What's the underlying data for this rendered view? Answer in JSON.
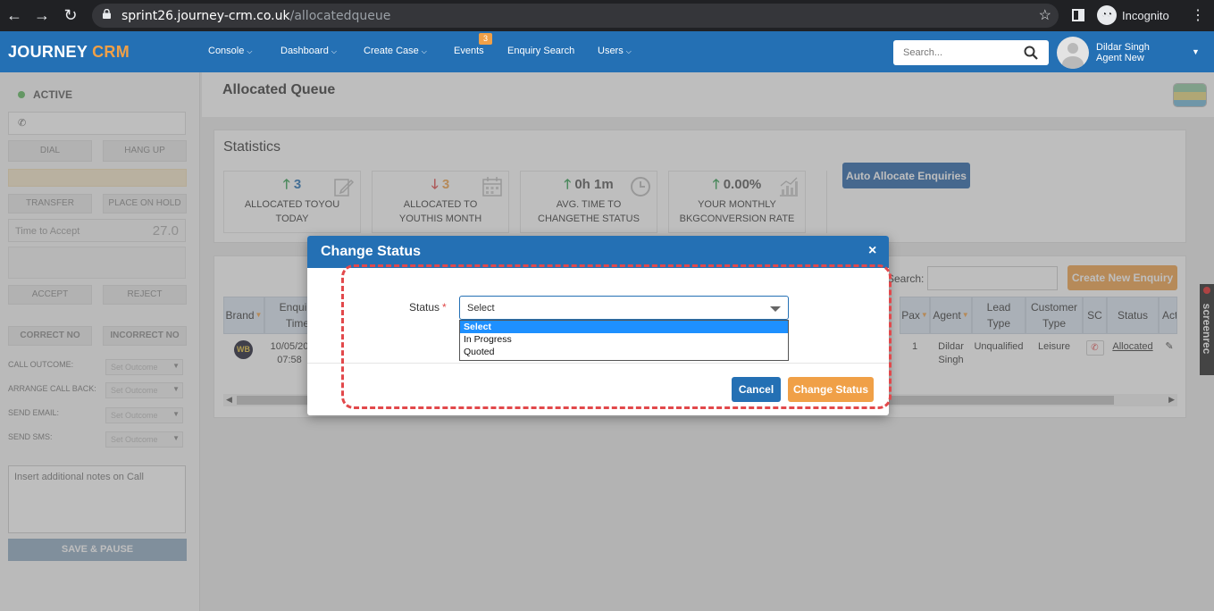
{
  "browser": {
    "url_host": "sprint26.journey-crm.co.uk",
    "url_path": "/allocatedqueue",
    "incognito_label": "Incognito"
  },
  "app": {
    "logo_main": "JOURNEY ",
    "logo_accent": "CRM",
    "menu": [
      {
        "label": "Console",
        "caret": true
      },
      {
        "label": "Dashboard",
        "caret": true
      },
      {
        "label": "Create Case",
        "caret": true
      },
      {
        "label": "Events",
        "caret": false,
        "badge": "3"
      },
      {
        "label": "Enquiry Search",
        "caret": false
      },
      {
        "label": "Users",
        "caret": true
      }
    ],
    "search_placeholder": "Search...",
    "user_name": "Dildar Singh",
    "user_role": "Agent New"
  },
  "left_panel": {
    "status": "ACTIVE",
    "dial": "DIAL",
    "hang_up": "HANG UP",
    "transfer": "TRANSFER",
    "place_on_hold": "PLACE ON HOLD",
    "time_to_accept": "Time to Accept",
    "time_value": "27.0",
    "accept": "ACCEPT",
    "reject": "REJECT",
    "correct_no": "CORRECT NO",
    "incorrect_no": "INCORRECT NO",
    "rows": [
      {
        "label": "CALL OUTCOME:",
        "value": "Set Outcome"
      },
      {
        "label": "ARRANGE CALL BACK:",
        "value": "Set Outcome"
      },
      {
        "label": "SEND EMAIL:",
        "value": "Set Outcome"
      },
      {
        "label": "SEND SMS:",
        "value": "Set Outcome"
      }
    ],
    "notes_placeholder": "Insert additional notes on Call",
    "save_pause": "SAVE & PAUSE"
  },
  "page": {
    "title": "Allocated Queue",
    "stats_title": "Statistics",
    "stats": [
      {
        "value": "3",
        "trend": "up",
        "line1": "ALLOCATED TOYOU",
        "line2": "TODAY",
        "icon": "edit-icon"
      },
      {
        "value": "3",
        "trend": "down",
        "line1": "ALLOCATED TO",
        "line2": "YOUTHIS MONTH",
        "icon": "calendar-icon"
      },
      {
        "value": "0h 1m",
        "trend": "up",
        "line1": "AVG. TIME TO",
        "line2": "CHANGETHE STATUS",
        "icon": "clock-icon"
      },
      {
        "value": "0.00%",
        "trend": "up",
        "line1": "YOUR MONTHLY",
        "line2": "BKGCONVERSION RATE",
        "icon": "bar-chart-icon"
      }
    ],
    "auto_allocate": "Auto Allocate Enquiries",
    "search_label": "Search:",
    "create_new_enquiry": "Create New Enquiry",
    "table_headers": [
      "Brand",
      "Enquiry Time",
      "Pax",
      "Agent",
      "Lead Type",
      "Customer Type",
      "SC",
      "Status",
      "Act"
    ],
    "row": {
      "brand": "WB",
      "enquiry_date": "10/05/20",
      "enquiry_time": "07:58",
      "pax": "1",
      "agent_line1": "Dildar",
      "agent_line2": "Singh",
      "lead_type": "Unqualified",
      "customer_type": "Leisure",
      "status": "Allocated"
    }
  },
  "modal": {
    "title": "Change Status",
    "close": "×",
    "field_label": "Status",
    "required_mark": "*",
    "current_value": "Select",
    "options": [
      "Select",
      "In Progress",
      "Quoted"
    ],
    "selected_option": "Select",
    "cancel": "Cancel",
    "submit": "Change Status"
  },
  "watermark": "screenrec",
  "colors": {
    "primary": "#2470b4",
    "accent": "#f0a047",
    "highlight_dash": "#e2484b",
    "success": "#2e9e4f",
    "danger": "#e04848"
  }
}
